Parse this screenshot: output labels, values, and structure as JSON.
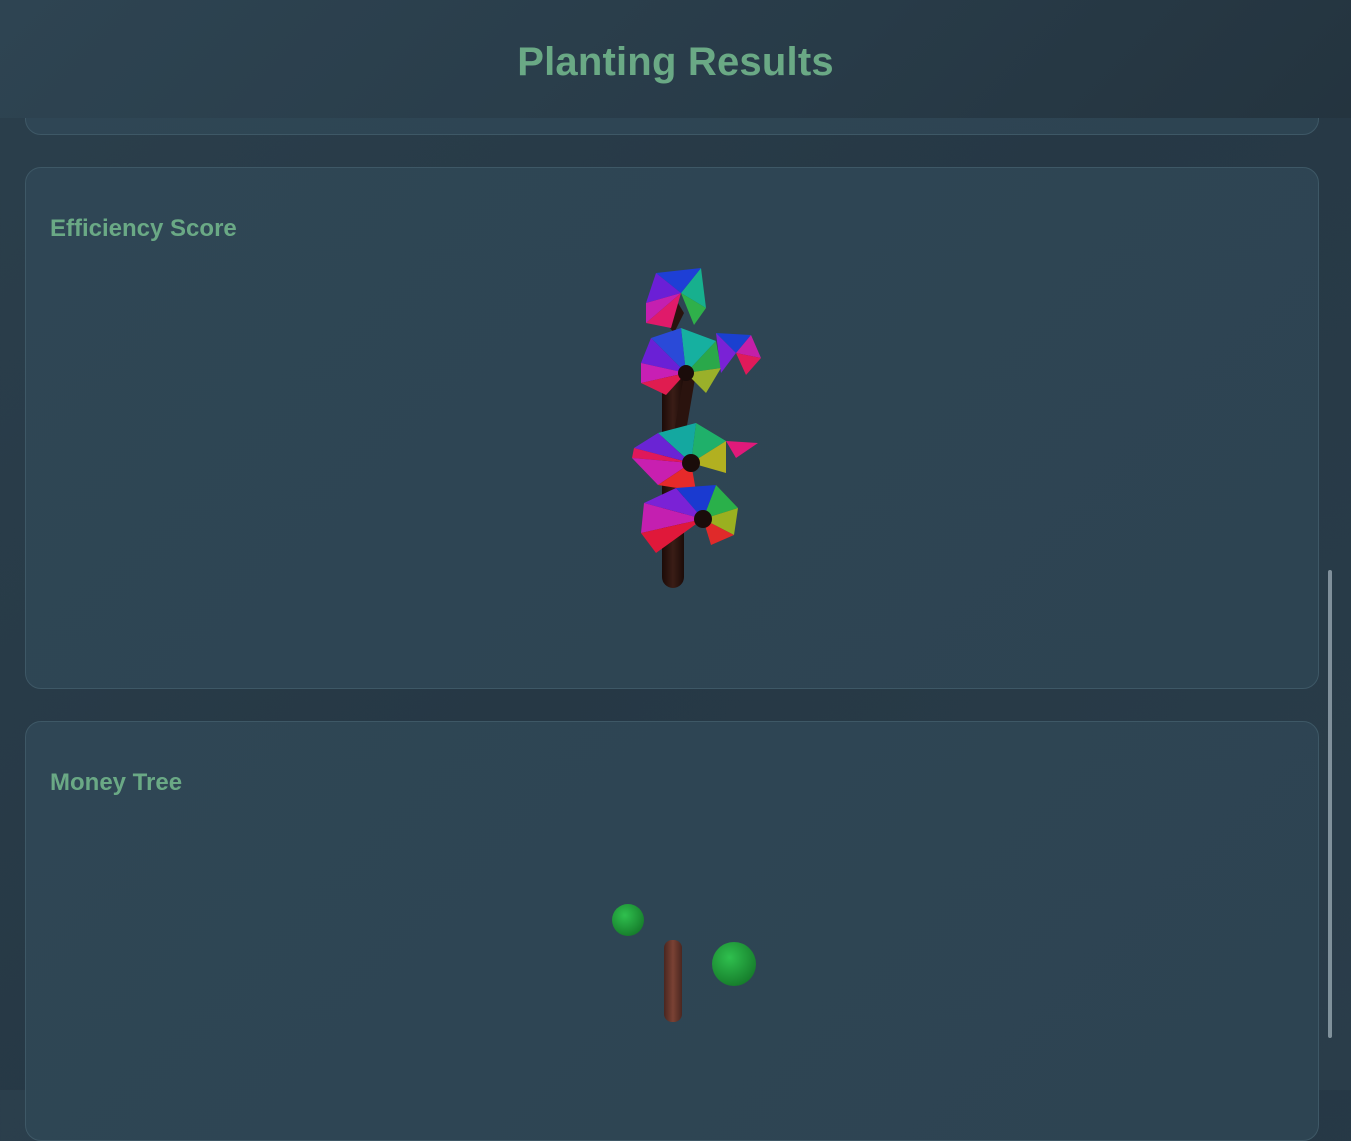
{
  "header": {
    "title": "Planting Results"
  },
  "cards": [
    {
      "title": "Efficiency Score",
      "visual": "rainbow-tree-3d"
    },
    {
      "title": "Money Tree",
      "visual": "money-tree-3d"
    }
  ],
  "colors": {
    "accent": "#6aa985",
    "background": "#2b3f4c",
    "card": "#2f4655",
    "trunk": "#2a1410",
    "money_trunk": "#6b3a2e",
    "leaf": "#1f9a3a"
  }
}
